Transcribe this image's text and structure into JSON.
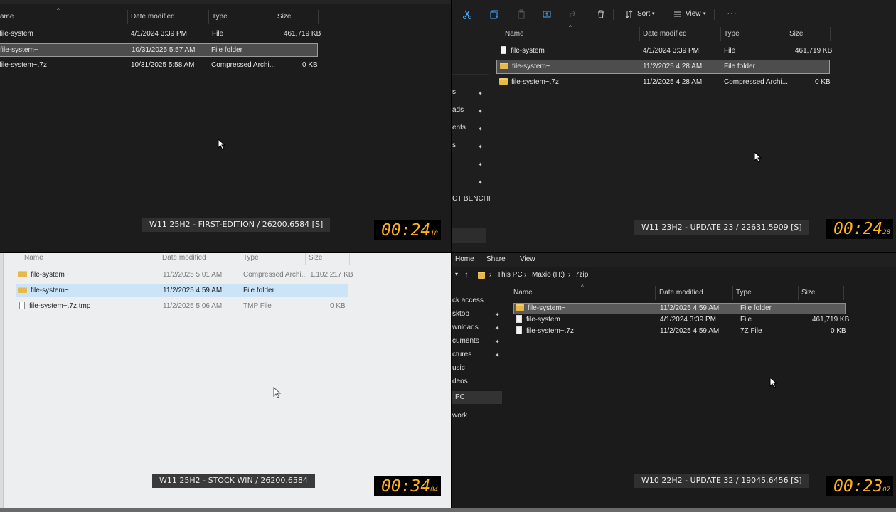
{
  "columns": {
    "name": "Name",
    "date": "Date modified",
    "type": "Type",
    "size": "Size",
    "name_truncated": "ame"
  },
  "q1": {
    "rows": [
      {
        "name": "file-system",
        "date": "4/1/2024 3:39 PM",
        "type": "File",
        "size": "461,719 KB",
        "icon": "file-icon"
      },
      {
        "name": "file-system~",
        "date": "10/31/2025 5:57 AM",
        "type": "File folder",
        "size": "",
        "icon": "folder-icon"
      },
      {
        "name": "file-system~.7z",
        "date": "10/31/2025 5:58 AM",
        "type": "Compressed Archi...",
        "size": "0 KB",
        "icon": "file-icon"
      }
    ],
    "label": "W11 25H2 - FIRST-EDITION  / 26200.6584 [S]",
    "timer_main": "00:24",
    "timer_ms": "18"
  },
  "q2": {
    "toolbar": {
      "sort": "Sort",
      "view": "View",
      "more": "···"
    },
    "nav": [
      "s",
      "ads",
      "ents",
      "s",
      "",
      "",
      "CT BENCHI"
    ],
    "rows": [
      {
        "name": "file-system",
        "date": "4/1/2024 3:39 PM",
        "type": "File",
        "size": "461,719 KB",
        "icon": "file-icon"
      },
      {
        "name": "file-system~",
        "date": "11/2/2025 4:28 AM",
        "type": "File folder",
        "size": "",
        "icon": "folder-icon"
      },
      {
        "name": "file-system~.7z",
        "date": "11/2/2025 4:28 AM",
        "type": "Compressed Archi...",
        "size": "0 KB",
        "icon": "folder-icon"
      }
    ],
    "label": "W11 23H2 - UPDATE 23  / 22631.5909 [S]",
    "timer_main": "00:24",
    "timer_ms": "28"
  },
  "q3": {
    "rows": [
      {
        "name": "file-system~",
        "date": "11/2/2025 5:01 AM",
        "type": "Compressed Archi...",
        "size": "1,102,217 KB",
        "icon": "folder-icon"
      },
      {
        "name": "file-system~",
        "date": "11/2/2025 4:59 AM",
        "type": "File folder",
        "size": "",
        "icon": "folder-icon"
      },
      {
        "name": "file-system~.7z.tmp",
        "date": "11/2/2025 5:06 AM",
        "type": "TMP File",
        "size": "0 KB",
        "icon": "file-icon"
      }
    ],
    "label": "W11 25H2 - STOCK WIN  / 26200.6584",
    "timer_main": "00:34",
    "timer_ms": "84"
  },
  "q4": {
    "menu": {
      "home": "Home",
      "share": "Share",
      "view": "View"
    },
    "breadcrumb": [
      "This PC",
      "Maxio (H:)",
      "7zip"
    ],
    "nav": [
      "ck access",
      "sktop",
      "wnloads",
      "cuments",
      "ctures",
      "usic",
      "deos",
      "PC",
      "work"
    ],
    "rows": [
      {
        "name": "file-system~",
        "date": "11/2/2025 4:59 AM",
        "type": "File folder",
        "size": "",
        "icon": "folder-icon"
      },
      {
        "name": "file-system",
        "date": "4/1/2024 3:39 PM",
        "type": "File",
        "size": "461,719 KB",
        "icon": "file-icon"
      },
      {
        "name": "file-system~.7z",
        "date": "11/2/2025 4:59 AM",
        "type": "7Z File",
        "size": "0 KB",
        "icon": "file-icon"
      }
    ],
    "label": "W10 22H2 - UPDATE 32  / 19045.6456 [S]",
    "timer_main": "00:23",
    "timer_ms": "07"
  },
  "colors": {
    "timer": "#ffb21e",
    "selection_light": "#cce4f7",
    "folder": "#e8b84a"
  }
}
